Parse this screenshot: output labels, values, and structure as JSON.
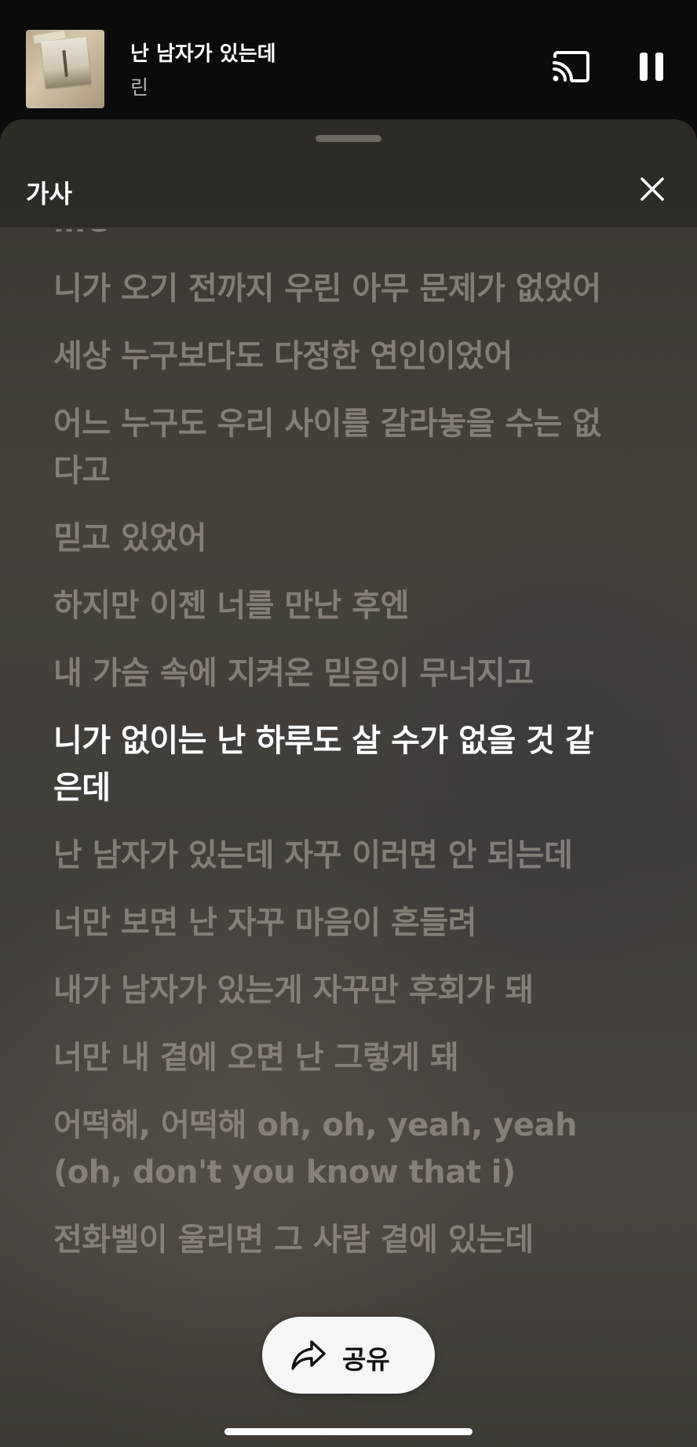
{
  "now_playing": {
    "title": "난 남자가 있는데",
    "artist": "린",
    "cast_icon": "cast-icon",
    "pause_icon": "pause-icon"
  },
  "lyrics_sheet": {
    "title": "가사",
    "close_icon": "close-icon",
    "lines": [
      {
        "text": "life",
        "active": false
      },
      {
        "text": "니가 오기 전까지 우린 아무 문제가 없었어",
        "active": false
      },
      {
        "text": "세상 누구보다도 다정한 연인이었어",
        "active": false
      },
      {
        "text": "어느 누구도 우리 사이를 갈라놓을 수는 없다고",
        "active": false
      },
      {
        "text": "믿고 있었어",
        "active": false
      },
      {
        "text": "하지만 이젠 너를 만난 후엔",
        "active": false
      },
      {
        "text": "내 가슴 속에 지켜온 믿음이 무너지고",
        "active": false
      },
      {
        "text": "니가 없이는 난 하루도 살 수가 없을 것 같은데",
        "active": true
      },
      {
        "text": "난 남자가 있는데 자꾸 이러면 안 되는데",
        "active": false
      },
      {
        "text": "너만 보면 난 자꾸 마음이 흔들려",
        "active": false
      },
      {
        "text": "내가 남자가 있는게 자꾸만 후회가 돼",
        "active": false
      },
      {
        "text": "너만 내 곁에 오면 난 그렇게 돼",
        "active": false
      },
      {
        "text": "어떡해, 어떡해 oh, oh, yeah, yeah (oh, don't you know that i)",
        "active": false
      },
      {
        "text": "전화벨이 울리면 그 사람 곁에 있는데",
        "active": false
      }
    ]
  },
  "share_button": {
    "label": "공유",
    "icon": "share-icon",
    "background": "#f6f6f6"
  },
  "colors": {
    "inactive_lyric": "#969088",
    "active_lyric": "#ffffff",
    "header_bg": "#0b0b0b"
  }
}
